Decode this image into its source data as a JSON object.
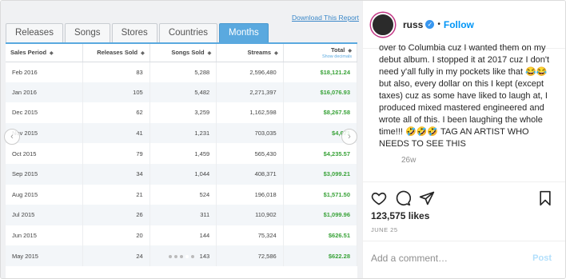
{
  "report": {
    "download_label": "Download This Report",
    "tabs": [
      {
        "label": "Releases",
        "active": false
      },
      {
        "label": "Songs",
        "active": false
      },
      {
        "label": "Stores",
        "active": false
      },
      {
        "label": "Countries",
        "active": false
      },
      {
        "label": "Months",
        "active": true
      }
    ],
    "columns": [
      "Sales Period",
      "Releases Sold",
      "Songs Sold",
      "Streams",
      "Total"
    ],
    "total_sub": "Show decimals",
    "rows": [
      [
        "Feb 2016",
        "83",
        "5,288",
        "2,596,480",
        "$18,121.24"
      ],
      [
        "Jan 2016",
        "105",
        "5,482",
        "2,271,397",
        "$16,076.93"
      ],
      [
        "Dec 2015",
        "62",
        "3,259",
        "1,162,598",
        "$8,267.58"
      ],
      [
        "Nov 2015",
        "41",
        "1,231",
        "703,035",
        "$4,671"
      ],
      [
        "Oct 2015",
        "79",
        "1,459",
        "565,430",
        "$4,235.57"
      ],
      [
        "Sep 2015",
        "34",
        "1,044",
        "408,371",
        "$3,099.21"
      ],
      [
        "Aug 2015",
        "21",
        "524",
        "196,018",
        "$1,571.50"
      ],
      [
        "Jul 2015",
        "26",
        "311",
        "110,902",
        "$1,099.96"
      ],
      [
        "Jun 2015",
        "20",
        "144",
        "75,324",
        "$626.51"
      ],
      [
        "May 2015",
        "24",
        "143",
        "72,586",
        "$622.28"
      ]
    ]
  },
  "post": {
    "username": "russ",
    "follow_label": "Follow",
    "caption": "over to Columbia cuz I wanted them on my debut album. I stopped it at 2017 cuz I don't need y'all fully in my pockets like that 😂😂 but also, every dollar on this I kept (except taxes) cuz as some have liked to laugh at, I produced mixed mastered engineered and wrote all of this. I been laughing the whole time!!! 🤣🤣🤣 TAG AN ARTIST WHO NEEDS TO SEE THIS",
    "time_ago": "26w",
    "likes": "123,575 likes",
    "date": "JUNE 25",
    "comment_placeholder": "Add a comment…",
    "post_label": "Post"
  },
  "colors": {
    "accent_tab": "#5aa9df",
    "revenue_green": "#3aa33a",
    "link_blue": "#0095f6"
  }
}
